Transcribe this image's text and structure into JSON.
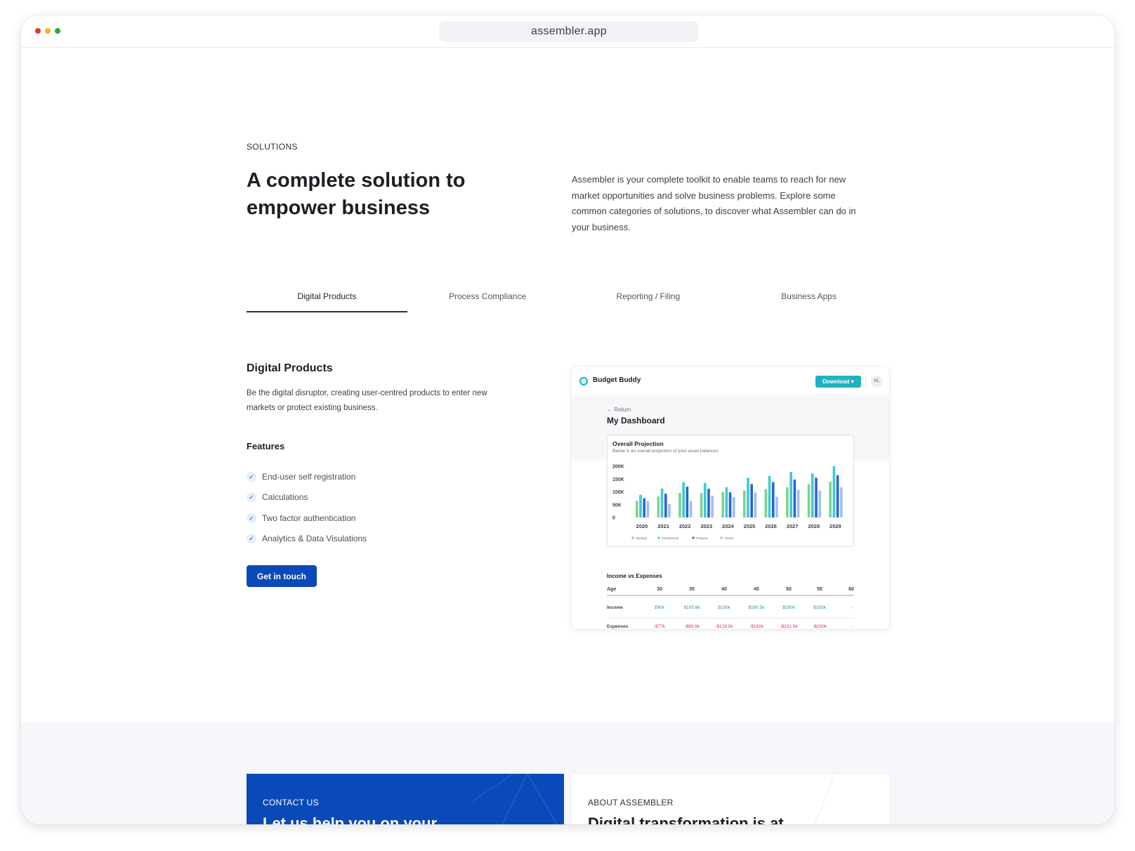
{
  "browser": {
    "url": "assembler.app",
    "dot_colors": [
      "#e0343c",
      "#f2b51d",
      "#27a844"
    ]
  },
  "hero": {
    "eyebrow": "SOLUTIONS",
    "title": "A complete solution to empower business",
    "description": "Assembler is your complete toolkit to enable teams to reach for new market opportunities and solve business problems. Explore some common categories of solutions, to discover what Assembler can do in your business."
  },
  "tabs": [
    {
      "label": "Digital Products",
      "active": true
    },
    {
      "label": "Process Compliance",
      "active": false
    },
    {
      "label": "Reporting / Filing",
      "active": false
    },
    {
      "label": "Business Apps",
      "active": false
    }
  ],
  "section": {
    "title": "Digital Products",
    "description": "Be the digital disruptor, creating user-centred products to enter new markets or protect existing business.",
    "features_title": "Features",
    "features": [
      "End-user self registration",
      "Calculations",
      "Two factor authentication",
      "Analytics & Data Visulations"
    ],
    "cta_label": "Get in touch"
  },
  "dashboard": {
    "app_name": "Budget Buddy",
    "download_label": "Download ▾",
    "avatar_initials": "KL",
    "return_label": "← Return",
    "title": "My Dashboard",
    "projection_title": "Overall Projection",
    "projection_subtitle": "Below is an overall projection of your asset balances",
    "income_expenses_title": "Income vs Expenses",
    "table": {
      "headers": [
        "Age",
        "30",
        "35",
        "40",
        "45",
        "50",
        "55",
        "60"
      ],
      "income": [
        "Income",
        "$90k",
        "$105.6k",
        "$150k",
        "$190.5k",
        "$250k",
        "$255k",
        "-"
      ],
      "expenses": [
        "Expenses",
        "-$77k",
        "-$99.9k",
        "-$128.5k",
        "-$182k",
        "-$231.5k",
        "-$200k",
        "-"
      ]
    },
    "colors": {
      "accent": "#1fb3bd",
      "income": "#2f9e55",
      "expenses": "#d23a46"
    }
  },
  "chart_data": {
    "type": "bar",
    "title": "Overall Projection",
    "subtitle": "Below is an overall projection of your asset balances",
    "categories": [
      "2020",
      "2021",
      "2022",
      "2023",
      "2024",
      "2025",
      "2026",
      "2027",
      "2028",
      "2029"
    ],
    "y_ticks": [
      "200K",
      "150K",
      "100K",
      "50K",
      "0"
    ],
    "ylim": [
      0,
      200000
    ],
    "legend_position": "bottom",
    "series": [
      {
        "name": "Savings",
        "color": "#7ed38a",
        "values": [
          65000,
          82000,
          96000,
          96000,
          100000,
          105000,
          110000,
          118000,
          130000,
          140000
        ]
      },
      {
        "name": "Investments",
        "color": "#3ec9d6",
        "values": [
          88000,
          113000,
          138000,
          135000,
          118000,
          155000,
          162000,
          178000,
          172000,
          200000
        ]
      },
      {
        "name": "Property",
        "color": "#2c62d6",
        "values": [
          75000,
          93000,
          120000,
          112000,
          98000,
          130000,
          138000,
          148000,
          155000,
          165000
        ]
      },
      {
        "name": "Assets",
        "color": "#9fc0ef",
        "values": [
          65000,
          53000,
          65000,
          85000,
          80000,
          98000,
          80000,
          108000,
          105000,
          118000
        ]
      }
    ]
  },
  "bottom": {
    "contact_eyebrow": "CONTACT US",
    "contact_title": "Let us help you on your",
    "about_eyebrow": "ABOUT ASSEMBLER",
    "about_title": "Digital transformation is at"
  }
}
